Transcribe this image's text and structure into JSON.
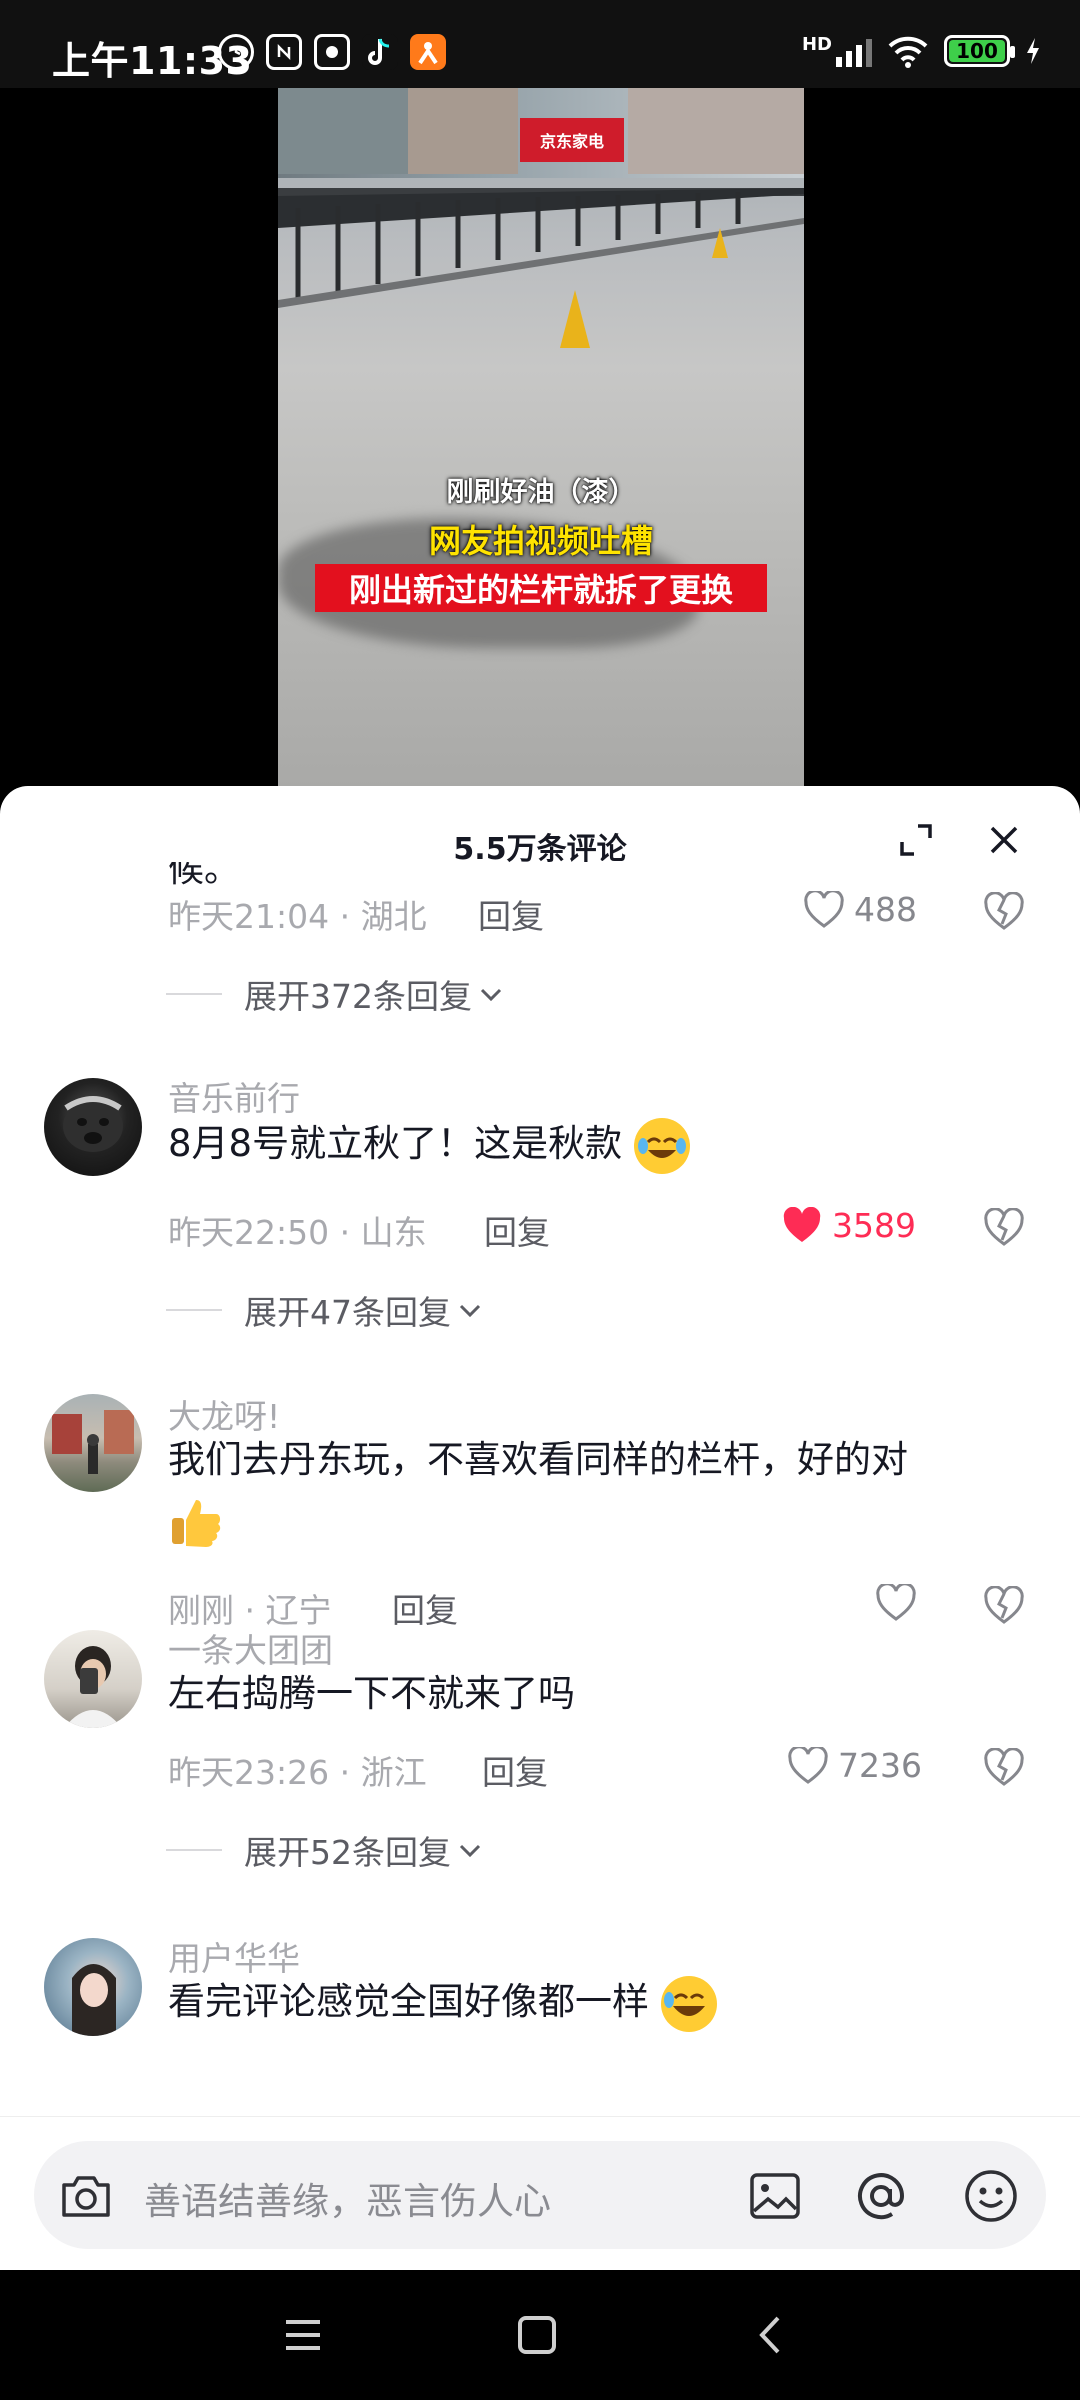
{
  "status_bar": {
    "time": "上午11:33",
    "battery": "100",
    "network": "HD"
  },
  "video": {
    "store_sign": "京东家电",
    "caption_line1": "刚刷好油（漆）",
    "caption_line2": "网友拍视频吐槽",
    "caption_line3": "刚出新过的栏杆就拆了更换"
  },
  "comments_panel": {
    "title": "5.5万条评论",
    "partial_comment": {
      "cut_text": "候。",
      "time": "昨天21:04",
      "location": "湖北",
      "reply_label": "回复",
      "likes": "488",
      "expand_label": "展开372条回复"
    },
    "comments": [
      {
        "username": "音乐前行",
        "text": "8月8号就立秋了！这是秋款",
        "time": "昨天22:50",
        "location": "山东",
        "reply_label": "回复",
        "likes": "3589",
        "liked": true,
        "expand_label": "展开47条回复"
      },
      {
        "username": "大龙呀!",
        "text": "我们去丹东玩，不喜欢看同样的栏杆，好的对",
        "time": "刚刚",
        "location": "辽宁",
        "reply_label": "回复",
        "likes": "",
        "liked": false
      },
      {
        "username": "一条大团团",
        "text": "左右捣腾一下不就来了吗",
        "time": "昨天23:26",
        "location": "浙江",
        "reply_label": "回复",
        "likes": "7236",
        "liked": false,
        "expand_label": "展开52条回复"
      },
      {
        "username": "用户华华",
        "text": "看完评论感觉全国好像都一样"
      }
    ]
  },
  "input_bar": {
    "placeholder": "善语结善缘，恶言伤人心"
  },
  "colors": {
    "accent": "#fe2c55",
    "caption_bg": "#e3101e",
    "caption_yellow": "#ffe300"
  },
  "icons": {
    "status": [
      "alarm-icon",
      "nfc-icon",
      "app-icon",
      "tiktok-icon",
      "app-orange-icon"
    ],
    "panel": [
      "expand-icon",
      "close-icon"
    ],
    "comment_actions": [
      "heart-icon",
      "dislike-heart-icon",
      "chevron-down-icon"
    ],
    "input": [
      "camera-icon",
      "image-icon",
      "at-icon",
      "emoji-icon"
    ],
    "nav": [
      "menu-icon",
      "home-icon",
      "back-icon"
    ]
  }
}
